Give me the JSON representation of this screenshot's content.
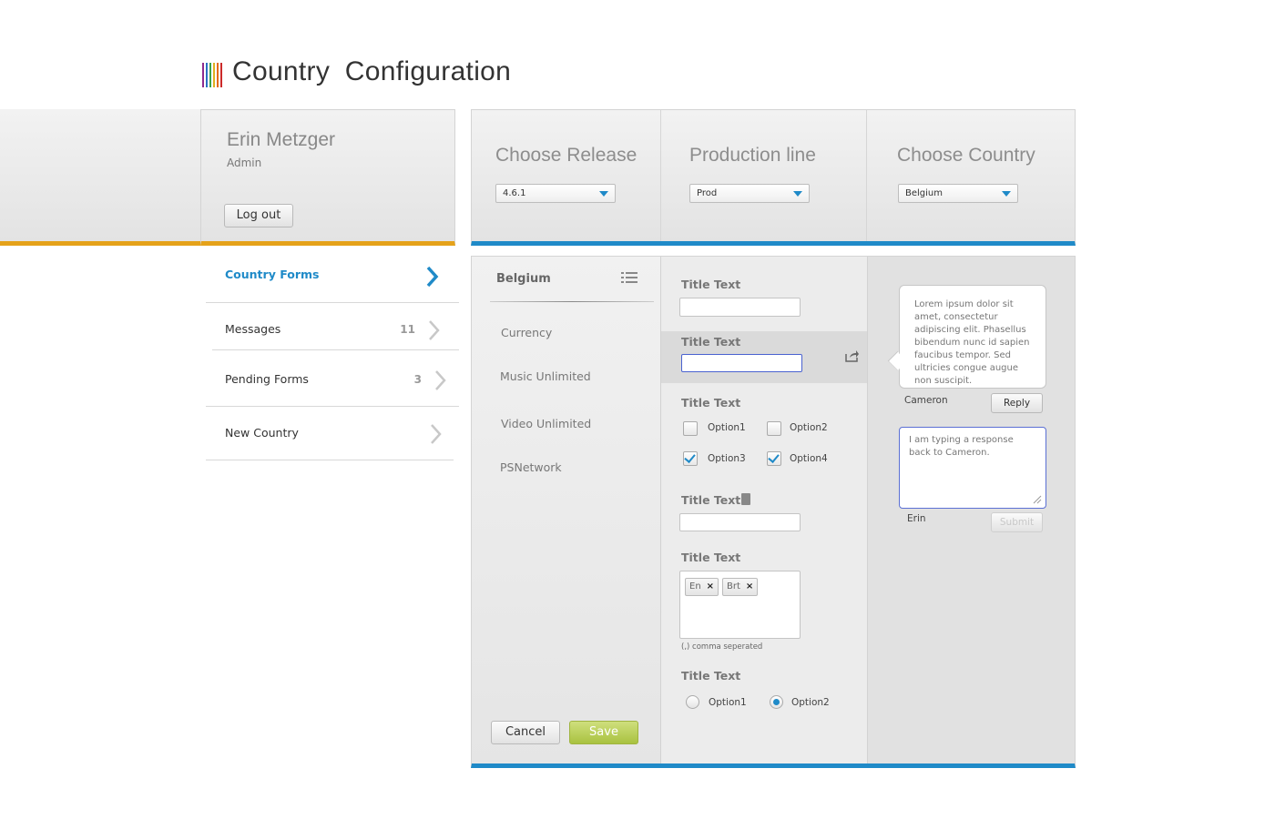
{
  "app": {
    "title": "Country  Configuration",
    "logo_colors": [
      "#8e2b8e",
      "#2a6fc4",
      "#3aa24a",
      "#e0b020",
      "#e46a1a",
      "#cc2a2a"
    ]
  },
  "user": {
    "name": "Erin Metzger",
    "role": "Admin",
    "logout_label": "Log out"
  },
  "selectors": [
    {
      "label": "Choose Release",
      "value": "4.6.1"
    },
    {
      "label": "Production line",
      "value": "Prod"
    },
    {
      "label": "Choose Country",
      "value": "Belgium"
    }
  ],
  "nav": {
    "items": [
      {
        "label": "Country Forms",
        "count": "",
        "active": true
      },
      {
        "label": "Messages",
        "count": "11",
        "active": false
      },
      {
        "label": "Pending Forms",
        "count": "3",
        "active": false
      },
      {
        "label": "New Country",
        "count": "",
        "active": false
      }
    ]
  },
  "country_panel": {
    "title": "Belgium",
    "items": [
      "Currency",
      "Music Unlimited",
      "Video Unlimited",
      "PSNetwork"
    ],
    "cancel_label": "Cancel",
    "save_label": "Save"
  },
  "form": {
    "field1": {
      "title": "Title Text",
      "value": ""
    },
    "field2": {
      "title": "Title Text",
      "value": ""
    },
    "checkbox_group": {
      "title": "Title Text",
      "options": [
        {
          "label": "Option1",
          "checked": false
        },
        {
          "label": "Option2",
          "checked": false
        },
        {
          "label": "Option3",
          "checked": true
        },
        {
          "label": "Option4",
          "checked": true
        }
      ]
    },
    "field4": {
      "title": "Title Text",
      "value": ""
    },
    "tags": {
      "title": "Title Text",
      "items": [
        "En",
        "Brt"
      ],
      "remove_glyph": "×",
      "hint": "(,) comma seperated"
    },
    "radio_group": {
      "title": "Title Text",
      "options": [
        {
          "label": "Option1",
          "selected": false
        },
        {
          "label": "Option2",
          "selected": true
        }
      ]
    }
  },
  "comments": {
    "message": "Lorem ipsum dolor sit amet, consectetur adipiscing elit. Phasellus bibendum nunc id sapien faucibus tempor. Sed ultricies congue augue non suscipit.",
    "author": "Cameron",
    "reply_label": "Reply",
    "draft": "I am typing a response back to Cameron.",
    "draft_author": "Erin",
    "submit_label": "Submit"
  },
  "colors": {
    "accent_blue": "#1f8ac8",
    "accent_orange": "#e5a21a",
    "save_green": "#a9c240"
  }
}
